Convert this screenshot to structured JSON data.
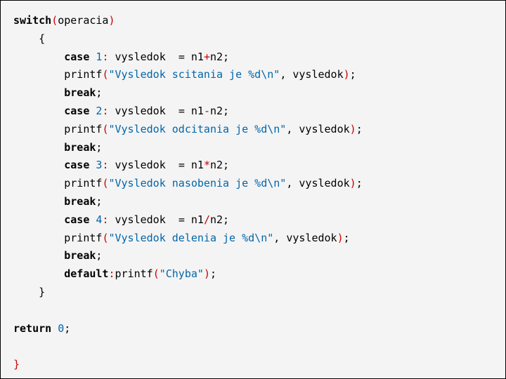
{
  "code": {
    "kw_switch": "switch",
    "ident_operacia": "operacia",
    "brace_open": "{",
    "brace_close": "}",
    "kw_case": "case",
    "kw_break": "break",
    "kw_default": "default",
    "kw_return": "return",
    "fn_printf": "printf",
    "ident_vysledok": "vysledok",
    "ident_n1": "n1",
    "ident_n2": "n2",
    "num_0": "0",
    "num_1": "1",
    "num_2": "2",
    "num_3": "3",
    "num_4": "4",
    "op_plus": "+",
    "op_minus": "-",
    "op_star": "*",
    "op_slash": "/",
    "op_eq": "=",
    "colon": ":",
    "semi": ";",
    "comma": ",",
    "str_scit": "\"Vysledok scitania je %d\\n\"",
    "str_odc": "\"Vysledok odcitania je %d\\n\"",
    "str_nas": "\"Vysledok nasobenia je %d\\n\"",
    "str_del": "\"Vysledok delenia je %d\\n\"",
    "str_chyba": "\"Chyba\""
  }
}
